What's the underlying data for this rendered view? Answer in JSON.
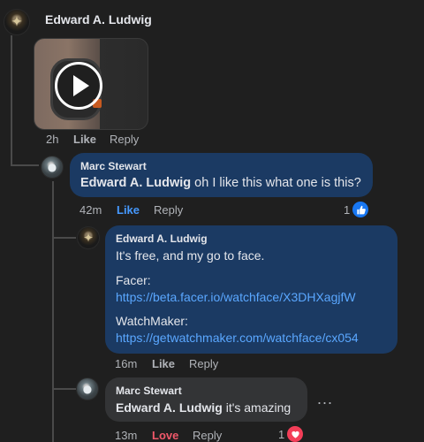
{
  "thread": {
    "top": {
      "author": "Edward A. Ludwig",
      "time": "2h",
      "like": "Like",
      "reply": "Reply",
      "attachment_icon": "play-icon"
    },
    "comments": [
      {
        "author": "Marc Stewart",
        "mention": "Edward A. Ludwig",
        "text": " oh I like this what one is this?",
        "time": "42m",
        "like": "Like",
        "reply": "Reply",
        "reaction_count": "1",
        "reaction_icon": "thumbs-up-icon"
      },
      {
        "author": "Edward A. Ludwig",
        "line1": "It's free, and my go to face.",
        "facer_label": "Facer:",
        "facer_link": "https://beta.facer.io/watchface/X3DHXagjfW",
        "watchmaker_label": "WatchMaker:",
        "watchmaker_link": "https://getwatchmaker.com/watchface/cx054",
        "time": "16m",
        "like": "Like",
        "reply": "Reply"
      },
      {
        "author": "Marc Stewart",
        "mention": "Edward A. Ludwig",
        "text": " it's amazing",
        "time": "13m",
        "love": "Love",
        "reply": "Reply",
        "reaction_count": "1",
        "reaction_icon": "heart-icon",
        "more": "..."
      }
    ]
  },
  "colors": {
    "background": "#1f1f1f",
    "blue_bubble": "#1b3a63",
    "gray_bubble": "#333436",
    "link": "#5aa7ff",
    "like_active": "#4599ff",
    "love": "#f0586a"
  }
}
